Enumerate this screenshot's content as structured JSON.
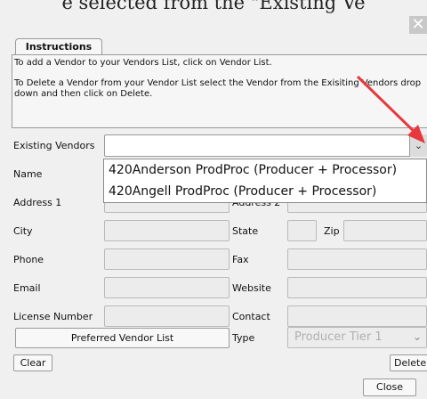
{
  "caption": "e selected from the \"Existing Ve",
  "window": {
    "close_glyph": "✕"
  },
  "tab": {
    "label": "Instructions"
  },
  "instructions": {
    "line1": "To add a Vendor to your Vendors List, click on Vendor List.",
    "line2": "To Delete a Vendor from your Vendor List select the Vendor from the Exisiting Vendors drop down and then click on Delete."
  },
  "form": {
    "existing_vendors_label": "Existing Vendors",
    "existing_vendors_value": "",
    "dropdown_options": [
      "420Anderson ProdProc (Producer + Processor)",
      "420Angell ProdProc (Producer + Processor)"
    ],
    "name_label": "Name",
    "address1_label": "Address 1",
    "address2_label": "Address 2",
    "city_label": "City",
    "state_label": "State",
    "zip_label": "Zip",
    "phone_label": "Phone",
    "fax_label": "Fax",
    "email_label": "Email",
    "website_label": "Website",
    "license_label": "License Number",
    "contact_label": "Contact",
    "type_label": "Type",
    "type_value": "Producer Tier 1"
  },
  "buttons": {
    "preferred": "Preferred Vendor List",
    "clear": "Clear",
    "delete": "Delete",
    "close": "Close"
  },
  "accent": {
    "annotation_arrow": "#e8383d"
  }
}
